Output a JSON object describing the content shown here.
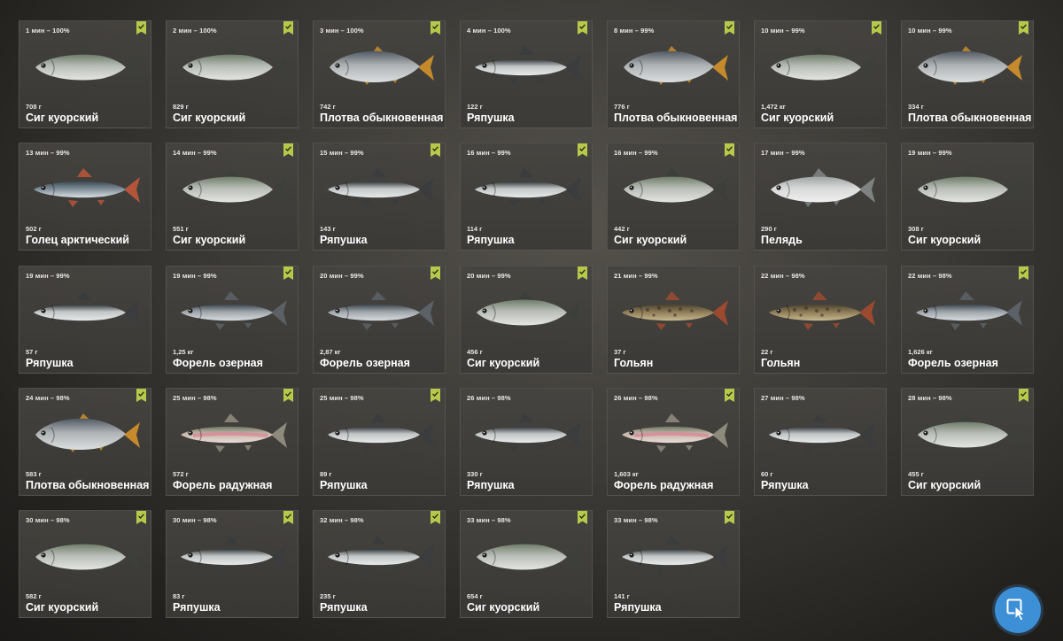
{
  "catches": [
    {
      "time": "1 мин – 100%",
      "weight": "708 г",
      "name": "Сиг куорский",
      "marked": true,
      "fish": "whitefish-icon"
    },
    {
      "time": "2 мин – 100%",
      "weight": "829 г",
      "name": "Сиг куорский",
      "marked": true,
      "fish": "whitefish-icon"
    },
    {
      "time": "3 мин – 100%",
      "weight": "742 г",
      "name": "Плотва обыкновенная",
      "marked": true,
      "fish": "roach-icon"
    },
    {
      "time": "4 мин – 100%",
      "weight": "122 г",
      "name": "Ряпушка",
      "marked": true,
      "fish": "vendace-icon"
    },
    {
      "time": "8 мин – 99%",
      "weight": "776 г",
      "name": "Плотва обыкновенная",
      "marked": true,
      "fish": "roach-icon"
    },
    {
      "time": "10 мин – 99%",
      "weight": "1,472 кг",
      "name": "Сиг куорский",
      "marked": true,
      "fish": "whitefish-icon"
    },
    {
      "time": "10 мин – 99%",
      "weight": "334 г",
      "name": "Плотва обыкновенная",
      "marked": true,
      "fish": "roach-icon"
    },
    {
      "time": "13 мин – 99%",
      "weight": "502 г",
      "name": "Голец арктический",
      "marked": false,
      "fish": "char-icon"
    },
    {
      "time": "14 мин – 99%",
      "weight": "551 г",
      "name": "Сиг куорский",
      "marked": true,
      "fish": "whitefish-icon"
    },
    {
      "time": "15 мин – 99%",
      "weight": "143 г",
      "name": "Ряпушка",
      "marked": true,
      "fish": "vendace-icon"
    },
    {
      "time": "16 мин – 99%",
      "weight": "114 г",
      "name": "Ряпушка",
      "marked": true,
      "fish": "vendace-icon"
    },
    {
      "time": "16 мин – 99%",
      "weight": "442 г",
      "name": "Сиг куорский",
      "marked": true,
      "fish": "whitefish-icon"
    },
    {
      "time": "17 мин – 99%",
      "weight": "290 г",
      "name": "Пелядь",
      "marked": false,
      "fish": "peled-icon"
    },
    {
      "time": "19 мин – 99%",
      "weight": "308 г",
      "name": "Сиг куорский",
      "marked": false,
      "fish": "whitefish-icon"
    },
    {
      "time": "19 мин – 99%",
      "weight": "57 г",
      "name": "Ряпушка",
      "marked": false,
      "fish": "vendace-icon"
    },
    {
      "time": "19 мин – 99%",
      "weight": "1,25 кг",
      "name": "Форель озерная",
      "marked": true,
      "fish": "lake-trout-icon"
    },
    {
      "time": "20 мин – 99%",
      "weight": "2,87 кг",
      "name": "Форель озерная",
      "marked": true,
      "fish": "lake-trout-icon"
    },
    {
      "time": "20 мин – 99%",
      "weight": "456 г",
      "name": "Сиг куорский",
      "marked": true,
      "fish": "whitefish-icon"
    },
    {
      "time": "21 мин – 99%",
      "weight": "37 г",
      "name": "Гольян",
      "marked": false,
      "fish": "minnow-icon"
    },
    {
      "time": "22 мин – 98%",
      "weight": "22 г",
      "name": "Гольян",
      "marked": false,
      "fish": "minnow-icon"
    },
    {
      "time": "22 мин – 98%",
      "weight": "1,626 кг",
      "name": "Форель озерная",
      "marked": true,
      "fish": "lake-trout-icon"
    },
    {
      "time": "24 мин – 98%",
      "weight": "583 г",
      "name": "Плотва обыкновенная",
      "marked": true,
      "fish": "roach-icon"
    },
    {
      "time": "25 мин – 98%",
      "weight": "572 г",
      "name": "Форель радужная",
      "marked": true,
      "fish": "rainbow-trout-icon"
    },
    {
      "time": "25 мин – 98%",
      "weight": "89 г",
      "name": "Ряпушка",
      "marked": true,
      "fish": "vendace-icon"
    },
    {
      "time": "26 мин – 98%",
      "weight": "330 г",
      "name": "Ряпушка",
      "marked": false,
      "fish": "vendace-icon"
    },
    {
      "time": "26 мин – 98%",
      "weight": "1,603 кг",
      "name": "Форель радужная",
      "marked": true,
      "fish": "rainbow-trout-icon"
    },
    {
      "time": "27 мин – 98%",
      "weight": "60 г",
      "name": "Ряпушка",
      "marked": false,
      "fish": "vendace-icon"
    },
    {
      "time": "28 мин – 98%",
      "weight": "455 г",
      "name": "Сиг куорский",
      "marked": true,
      "fish": "whitefish-icon"
    },
    {
      "time": "30 мин – 98%",
      "weight": "582 г",
      "name": "Сиг куорский",
      "marked": true,
      "fish": "whitefish-icon"
    },
    {
      "time": "30 мин – 98%",
      "weight": "83 г",
      "name": "Ряпушка",
      "marked": true,
      "fish": "vendace-icon"
    },
    {
      "time": "32 мин – 98%",
      "weight": "235 г",
      "name": "Ряпушка",
      "marked": true,
      "fish": "vendace-icon"
    },
    {
      "time": "33 мин – 98%",
      "weight": "654 г",
      "name": "Сиг куорский",
      "marked": true,
      "fish": "whitefish-icon"
    },
    {
      "time": "33 мин – 98%",
      "weight": "141 г",
      "name": "Ряпушка",
      "marked": true,
      "fish": "vendace-icon"
    }
  ],
  "colors": {
    "badge": "#b8c84a",
    "cursor_button": "#3d8fd6",
    "text": "#ffffff"
  },
  "fish_palette": {
    "whitefish-icon": {
      "body": "#b9bdb8",
      "back": "#6f7d6a",
      "belly": "#e4e6e0",
      "fin": "#3d3f3b"
    },
    "roach-icon": {
      "body": "#aeb2b4",
      "back": "#4f5862",
      "belly": "#dcdfe0",
      "fin": "#c58a2c"
    },
    "vendace-icon": {
      "body": "#c2c6c6",
      "back": "#2f3438",
      "belly": "#e8eaea",
      "fin": "#3a3c3d"
    },
    "char-icon": {
      "body": "#7c8a94",
      "back": "#3b4a55",
      "belly": "#d9dfe2",
      "fin": "#b4553a"
    },
    "peled-icon": {
      "body": "#d8dad8",
      "back": "#9ea3a2",
      "belly": "#eeefee",
      "fin": "#7e8281"
    },
    "lake-trout-icon": {
      "body": "#9ea5aa",
      "back": "#3c454d",
      "belly": "#d7dbdd",
      "fin": "#5b6166"
    },
    "minnow-icon": {
      "body": "#8c7a55",
      "back": "#4a4230",
      "belly": "#c7b98f",
      "fin": "#9b4a30"
    },
    "rainbow-trout-icon": {
      "body": "#c8b8ad",
      "back": "#707a66",
      "belly": "#e9dcd6",
      "fin": "#8e8a7c"
    }
  }
}
